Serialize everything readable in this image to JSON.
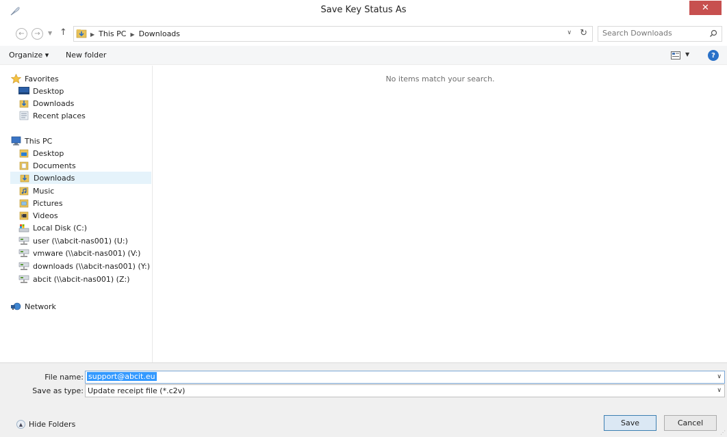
{
  "window": {
    "title": "Save Key Status As",
    "close_glyph": "✕"
  },
  "address": {
    "breadcrumbs": [
      "This PC",
      "Downloads"
    ],
    "search_placeholder": "Search Downloads"
  },
  "commands": {
    "organize": "Organize ▾",
    "new_folder": "New folder"
  },
  "nav": {
    "favorites": {
      "label": "Favorites",
      "items": [
        "Desktop",
        "Downloads",
        "Recent places"
      ]
    },
    "this_pc": {
      "label": "This PC",
      "items": [
        "Desktop",
        "Documents",
        "Downloads",
        "Music",
        "Pictures",
        "Videos",
        "Local Disk (C:)",
        "user (\\\\abcit-nas001) (U:)",
        "vmware (\\\\abcit-nas001) (V:)",
        "downloads (\\\\abcit-nas001) (Y:)",
        "abcit (\\\\abcit-nas001) (Z:)"
      ]
    },
    "network": {
      "label": "Network"
    },
    "selected": "Downloads"
  },
  "content": {
    "empty_message": "No items match your search."
  },
  "form": {
    "file_name_label": "File name:",
    "file_name_value": "support@abcit.eu",
    "save_type_label": "Save as type:",
    "save_type_value": "Update receipt file (*.c2v)"
  },
  "buttons": {
    "hide_folders": "Hide Folders",
    "save": "Save",
    "cancel": "Cancel"
  },
  "colors": {
    "close_button": "#c7504f",
    "selection": "#e5f3fb",
    "highlight": "#3399ff"
  }
}
